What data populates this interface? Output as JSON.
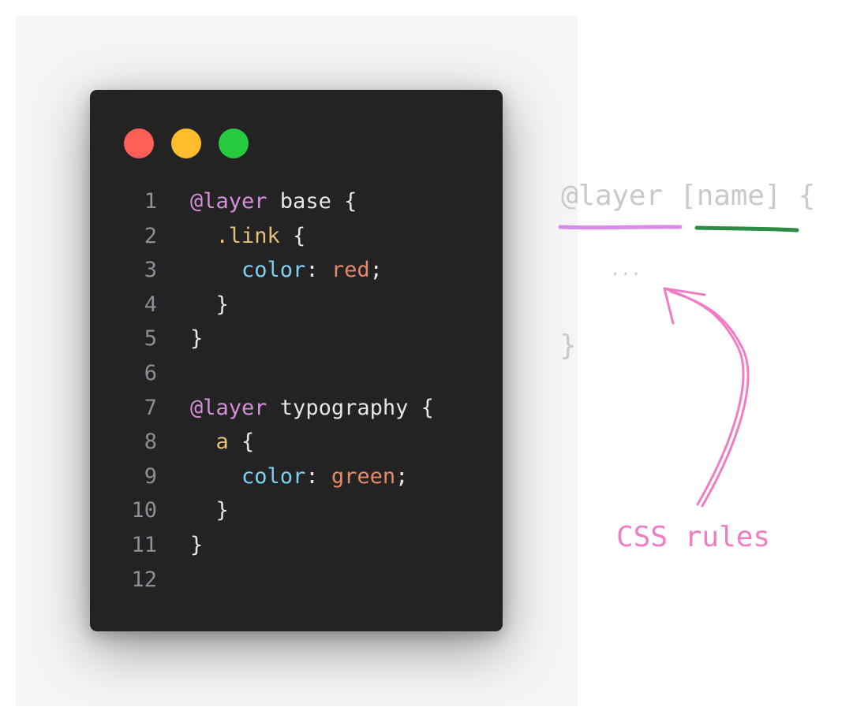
{
  "window_controls": [
    {
      "name": "close",
      "color": "#ff5f56"
    },
    {
      "name": "minimize",
      "color": "#ffbd2e"
    },
    {
      "name": "maximize",
      "color": "#27c93f"
    }
  ],
  "code": {
    "lines": [
      {
        "number": "1",
        "tokens": [
          {
            "t": "@layer",
            "k": "kw"
          },
          {
            "t": " base {",
            "k": "punc"
          }
        ]
      },
      {
        "number": "2",
        "tokens": [
          {
            "t": "  .link",
            "k": "sel"
          },
          {
            "t": " {",
            "k": "punc"
          }
        ]
      },
      {
        "number": "3",
        "tokens": [
          {
            "t": "    color",
            "k": "prop"
          },
          {
            "t": ": ",
            "k": "punc"
          },
          {
            "t": "red",
            "k": "val"
          },
          {
            "t": ";",
            "k": "punc"
          }
        ]
      },
      {
        "number": "4",
        "tokens": [
          {
            "t": "  }",
            "k": "punc"
          }
        ]
      },
      {
        "number": "5",
        "tokens": [
          {
            "t": "}",
            "k": "punc"
          }
        ]
      },
      {
        "number": "6",
        "tokens": []
      },
      {
        "number": "7",
        "tokens": [
          {
            "t": "@layer",
            "k": "kw"
          },
          {
            "t": " typography {",
            "k": "punc"
          }
        ]
      },
      {
        "number": "8",
        "tokens": [
          {
            "t": "  a",
            "k": "sel"
          },
          {
            "t": " {",
            "k": "punc"
          }
        ]
      },
      {
        "number": "9",
        "tokens": [
          {
            "t": "    color",
            "k": "prop"
          },
          {
            "t": ": ",
            "k": "punc"
          },
          {
            "t": "green",
            "k": "val"
          },
          {
            "t": ";",
            "k": "punc"
          }
        ]
      },
      {
        "number": "10",
        "tokens": [
          {
            "t": "  }",
            "k": "punc"
          }
        ]
      },
      {
        "number": "11",
        "tokens": [
          {
            "t": "}",
            "k": "punc"
          }
        ]
      },
      {
        "number": "12",
        "tokens": []
      }
    ]
  },
  "annotation": {
    "syntax_line": "@layer [name] {",
    "ellipsis": "...",
    "closing_brace": "}",
    "arrow_label": "CSS rules",
    "colors": {
      "layer_underline": "#d98be8",
      "name_underline": "#2e8b46",
      "arrow": "#f07dc4",
      "syntax_text": "#c9c9c9"
    }
  }
}
